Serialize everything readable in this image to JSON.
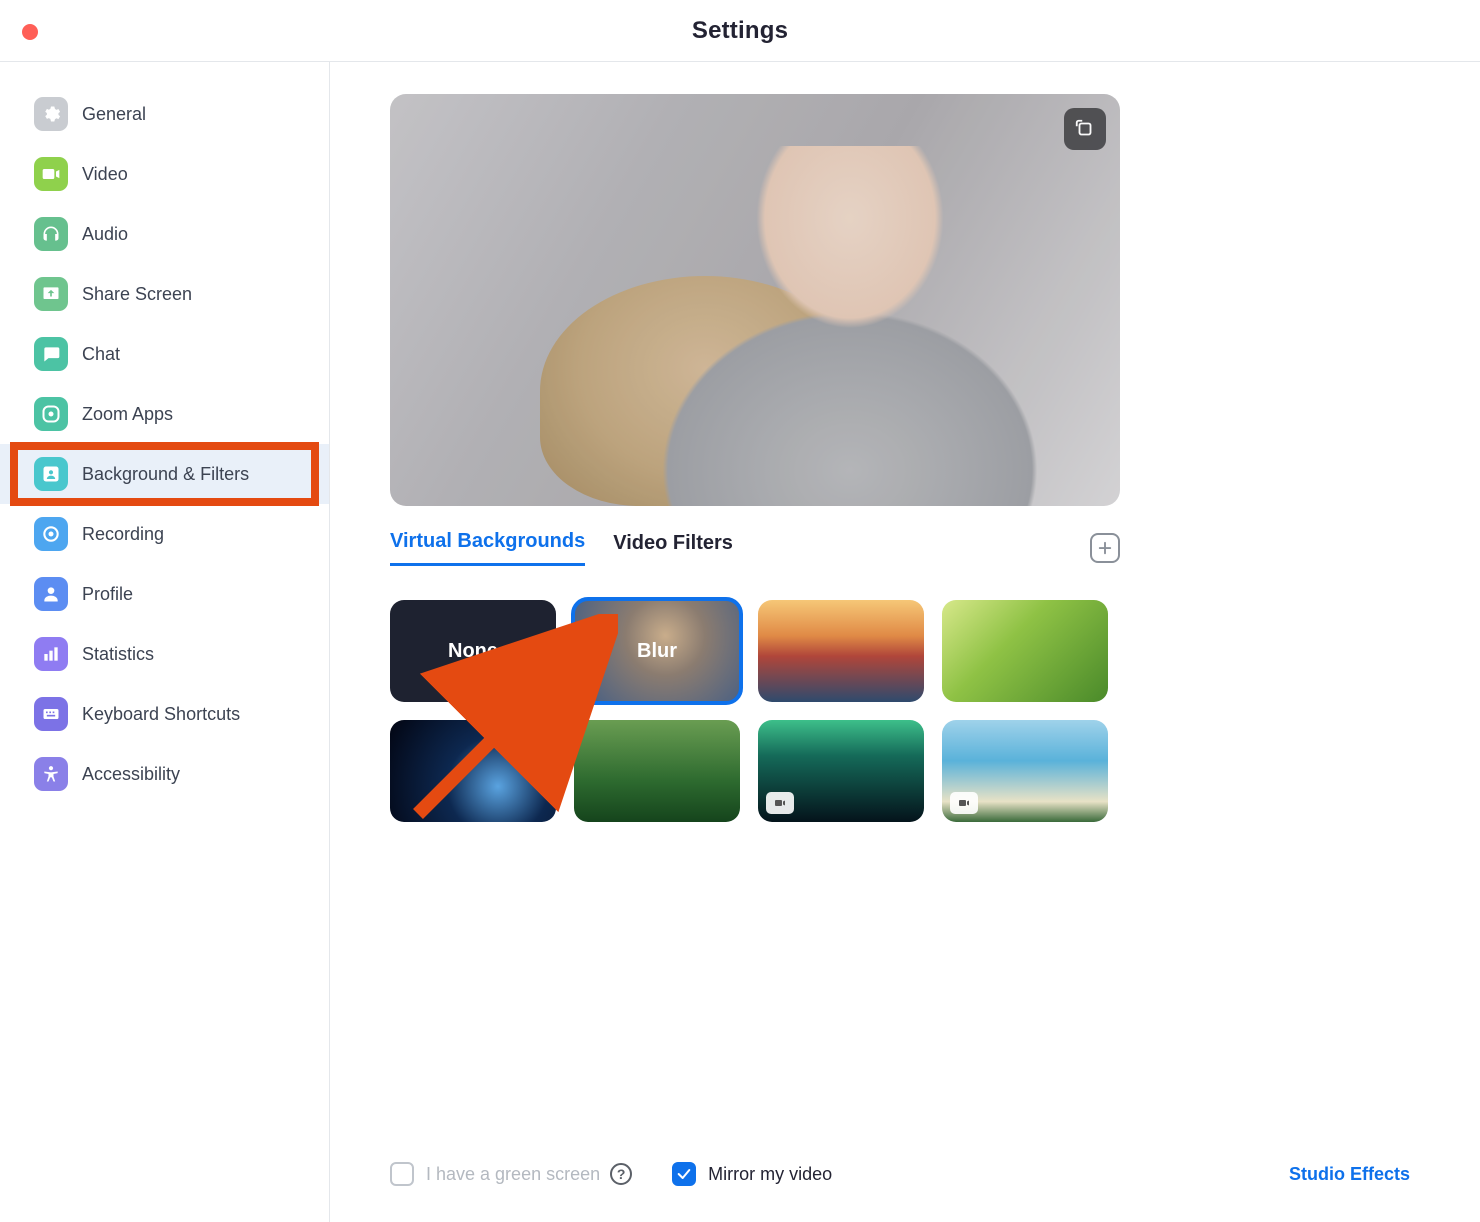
{
  "window": {
    "title": "Settings"
  },
  "sidebar": {
    "items": [
      {
        "key": "general",
        "label": "General",
        "iconColor": "#c9ccd1"
      },
      {
        "key": "video",
        "label": "Video",
        "iconColor": "#8fd14c"
      },
      {
        "key": "audio",
        "label": "Audio",
        "iconColor": "#66c08e"
      },
      {
        "key": "share",
        "label": "Share Screen",
        "iconColor": "#6fc58e"
      },
      {
        "key": "chat",
        "label": "Chat",
        "iconColor": "#4cc3a4"
      },
      {
        "key": "apps",
        "label": "Zoom Apps",
        "iconColor": "#4cc3a4"
      },
      {
        "key": "bgfilter",
        "label": "Background & Filters",
        "iconColor": "#49c7cd"
      },
      {
        "key": "record",
        "label": "Recording",
        "iconColor": "#4da6f0"
      },
      {
        "key": "profile",
        "label": "Profile",
        "iconColor": "#5c8df2"
      },
      {
        "key": "stats",
        "label": "Statistics",
        "iconColor": "#8f7cf2"
      },
      {
        "key": "keys",
        "label": "Keyboard Shortcuts",
        "iconColor": "#7c72e6"
      },
      {
        "key": "access",
        "label": "Accessibility",
        "iconColor": "#8a80e8"
      }
    ]
  },
  "tabs": {
    "virtual": "Virtual Backgrounds",
    "filters": "Video Filters"
  },
  "tiles": {
    "none": "None",
    "blur": "Blur"
  },
  "footer": {
    "green": "I have a green screen",
    "mirror": "Mirror my video",
    "studio": "Studio Effects"
  }
}
